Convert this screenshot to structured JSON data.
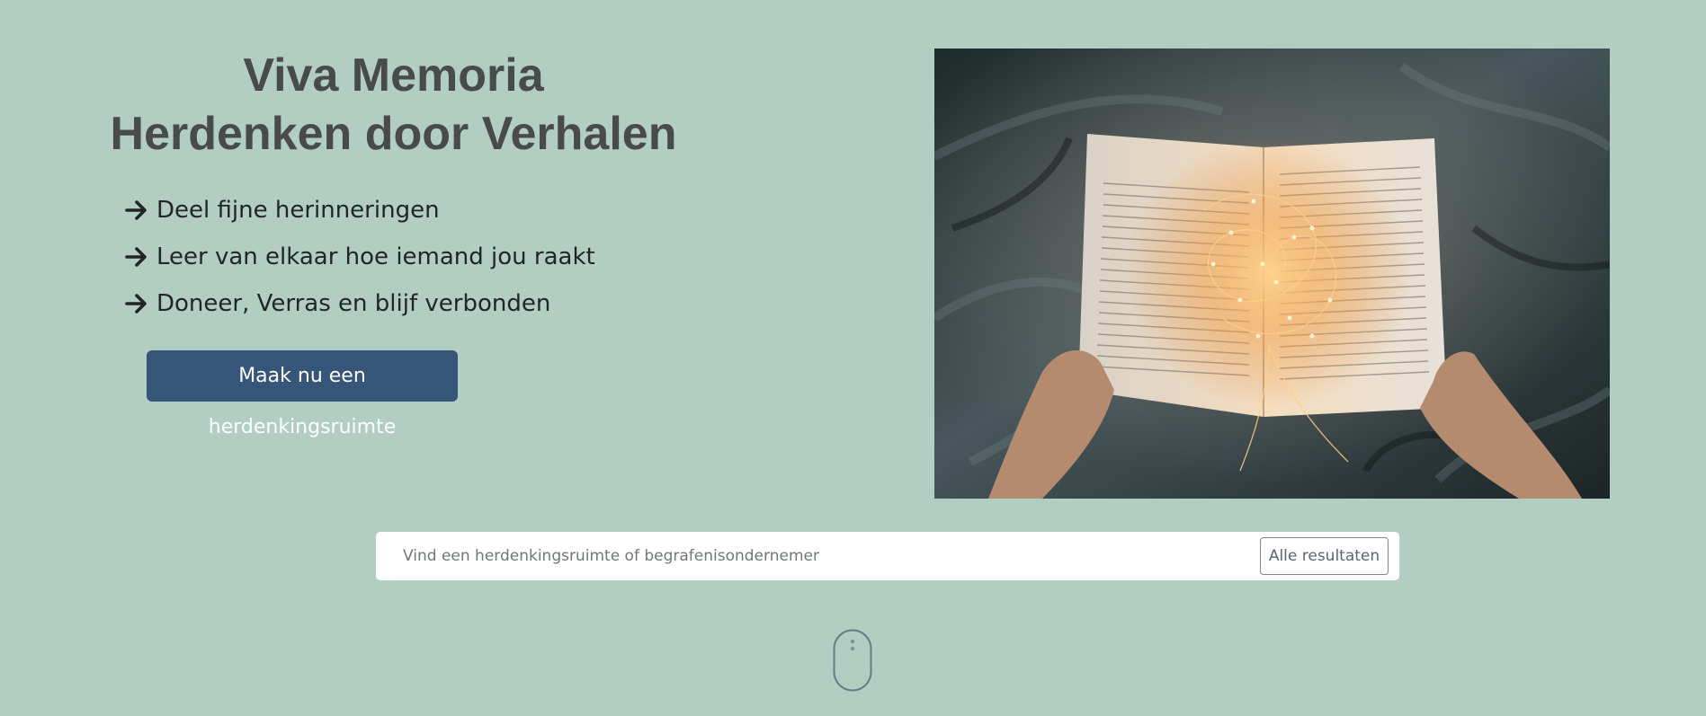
{
  "hero": {
    "title_line1": "Viva Memoria",
    "title_line2": "Herdenken door Verhalen",
    "features": [
      "Deel fijne herinneringen",
      "Leer van elkaar hoe iemand jou raakt",
      "Doneer, Verras en blijf verbonden"
    ],
    "feature_icon": "arrow-right-icon",
    "cta_label": "Maak nu een herdenkingsruimte"
  },
  "image": {
    "subject": "open book with fairy lights"
  },
  "search": {
    "placeholder": "Vind een herdenkingsruimte of begrafenisondernemer",
    "button_label": "Alle resultaten"
  },
  "scroll_indicator": {
    "icon": "mouse-scroll-icon"
  },
  "colors": {
    "background": "#b2cec3",
    "title": "#494b4a",
    "cta_background": "#355579",
    "cta_text": "#ffffff"
  }
}
